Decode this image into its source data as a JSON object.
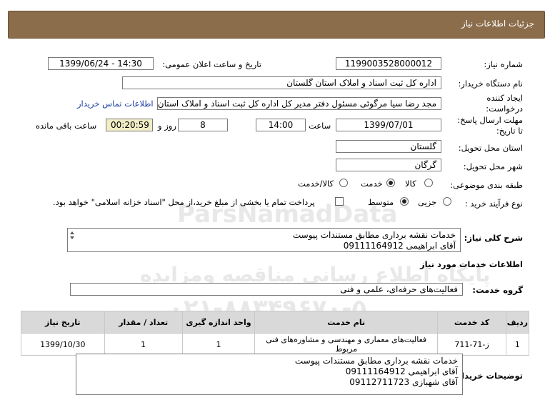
{
  "header": {
    "title": "جزئیات اطلاعات نیاز"
  },
  "fields": {
    "need_number_label": "شماره نیاز:",
    "need_number": "1199003528000012",
    "announce_label": "تاریخ و ساعت اعلان عمومی:",
    "announce_value": "1399/06/24 - 14:30",
    "buyer_org_label": "نام دستگاه خریدار:",
    "buyer_org": "اداره کل ثبت اسناد و املاک استان گلستان",
    "creator_label_1": "ایجاد کننده",
    "creator_label_2": "درخواست:",
    "creator": "مجد رضا سیا مرگوئی مسئول دفتر مدیر کل اداره کل ثبت اسناد و املاک استان",
    "contact_link": "اطلاعات تماس خریدار",
    "deadline_label_1": "مهلت ارسال پاسخ:",
    "deadline_label_2": "تا تاریخ:",
    "deadline_date": "1399/07/01",
    "time_label": "ساعت",
    "deadline_time": "14:00",
    "days": "8",
    "days_label": "روز و",
    "remaining": "00:20:59",
    "remaining_label": "ساعت باقی مانده",
    "province_label": "استان محل تحویل:",
    "province": "گلستان",
    "city_label": "شهر محل تحویل:",
    "city": "گرگان",
    "category_label": "طبقه بندی موضوعی:",
    "category_options": [
      "کالا",
      "خدمت",
      "کالا/خدمت"
    ],
    "category_selected": "خدمت",
    "process_label": "نوع فرآیند خرید :",
    "process_options": [
      "جزیی",
      "متوسط"
    ],
    "process_selected": "متوسط",
    "payment_note": "پرداخت تمام یا بخشی از مبلغ خرید،از محل \"اسناد خزانه اسلامی\" خواهد بود."
  },
  "summary": {
    "label": "شرح کلی نیاز:",
    "lines": [
      "خدمات نقشه برداری مطابق مستندات پیوست",
      "آقای ابراهیمی 09111164912"
    ]
  },
  "services_section_title": "اطلاعات خدمات مورد نیاز",
  "service_group": {
    "label": "گروه خدمت:",
    "value": "فعالیت‌های حرفه‌ای، علمی و فنی"
  },
  "table": {
    "headers": [
      "ردیف",
      "کد خدمت",
      "نام خدمت",
      "واحد اندازه گیری",
      "تعداد / مقدار",
      "تاریخ نیاز"
    ],
    "rows": [
      [
        "1",
        "ز-71-711",
        "فعالیت‌های معماری و مهندسی و مشاوره‌های فنی مربوط",
        "1",
        "1",
        "1399/10/30"
      ]
    ]
  },
  "buyer_notes": {
    "label": "توضیحات خریدار:",
    "lines": [
      "خدمات نقشه برداری مطابق مستندات پیوست",
      "آقای ابراهیمی 09111164912",
      "آقای شهبازی 09112711723"
    ]
  },
  "watermark": {
    "brand": "ParsNamadData",
    "line1": "پایگاه اطلاع رسانی مناقصه ومزایده",
    "line2": "۰۲۱-۸۸۳۴۹۶۷۰-۵"
  }
}
